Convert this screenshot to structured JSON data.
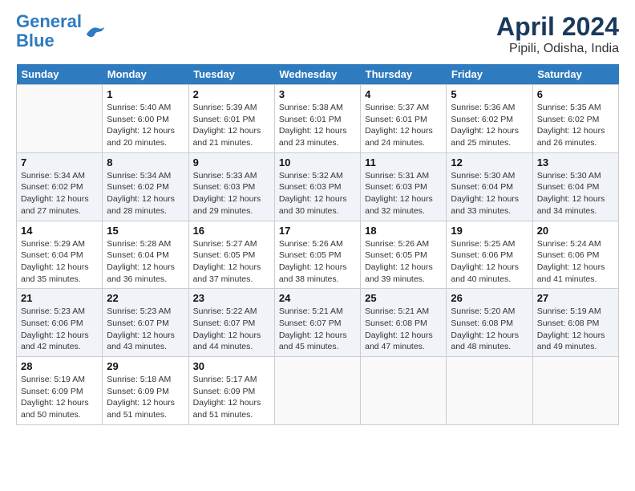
{
  "header": {
    "logo_line1": "General",
    "logo_line2": "Blue",
    "title": "April 2024",
    "subtitle": "Pipili, Odisha, India"
  },
  "days_of_week": [
    "Sunday",
    "Monday",
    "Tuesday",
    "Wednesday",
    "Thursday",
    "Friday",
    "Saturday"
  ],
  "weeks": [
    [
      {
        "day": "",
        "detail": ""
      },
      {
        "day": "1",
        "detail": "Sunrise: 5:40 AM\nSunset: 6:00 PM\nDaylight: 12 hours\nand 20 minutes."
      },
      {
        "day": "2",
        "detail": "Sunrise: 5:39 AM\nSunset: 6:01 PM\nDaylight: 12 hours\nand 21 minutes."
      },
      {
        "day": "3",
        "detail": "Sunrise: 5:38 AM\nSunset: 6:01 PM\nDaylight: 12 hours\nand 23 minutes."
      },
      {
        "day": "4",
        "detail": "Sunrise: 5:37 AM\nSunset: 6:01 PM\nDaylight: 12 hours\nand 24 minutes."
      },
      {
        "day": "5",
        "detail": "Sunrise: 5:36 AM\nSunset: 6:02 PM\nDaylight: 12 hours\nand 25 minutes."
      },
      {
        "day": "6",
        "detail": "Sunrise: 5:35 AM\nSunset: 6:02 PM\nDaylight: 12 hours\nand 26 minutes."
      }
    ],
    [
      {
        "day": "7",
        "detail": "Sunrise: 5:34 AM\nSunset: 6:02 PM\nDaylight: 12 hours\nand 27 minutes."
      },
      {
        "day": "8",
        "detail": "Sunrise: 5:34 AM\nSunset: 6:02 PM\nDaylight: 12 hours\nand 28 minutes."
      },
      {
        "day": "9",
        "detail": "Sunrise: 5:33 AM\nSunset: 6:03 PM\nDaylight: 12 hours\nand 29 minutes."
      },
      {
        "day": "10",
        "detail": "Sunrise: 5:32 AM\nSunset: 6:03 PM\nDaylight: 12 hours\nand 30 minutes."
      },
      {
        "day": "11",
        "detail": "Sunrise: 5:31 AM\nSunset: 6:03 PM\nDaylight: 12 hours\nand 32 minutes."
      },
      {
        "day": "12",
        "detail": "Sunrise: 5:30 AM\nSunset: 6:04 PM\nDaylight: 12 hours\nand 33 minutes."
      },
      {
        "day": "13",
        "detail": "Sunrise: 5:30 AM\nSunset: 6:04 PM\nDaylight: 12 hours\nand 34 minutes."
      }
    ],
    [
      {
        "day": "14",
        "detail": "Sunrise: 5:29 AM\nSunset: 6:04 PM\nDaylight: 12 hours\nand 35 minutes."
      },
      {
        "day": "15",
        "detail": "Sunrise: 5:28 AM\nSunset: 6:04 PM\nDaylight: 12 hours\nand 36 minutes."
      },
      {
        "day": "16",
        "detail": "Sunrise: 5:27 AM\nSunset: 6:05 PM\nDaylight: 12 hours\nand 37 minutes."
      },
      {
        "day": "17",
        "detail": "Sunrise: 5:26 AM\nSunset: 6:05 PM\nDaylight: 12 hours\nand 38 minutes."
      },
      {
        "day": "18",
        "detail": "Sunrise: 5:26 AM\nSunset: 6:05 PM\nDaylight: 12 hours\nand 39 minutes."
      },
      {
        "day": "19",
        "detail": "Sunrise: 5:25 AM\nSunset: 6:06 PM\nDaylight: 12 hours\nand 40 minutes."
      },
      {
        "day": "20",
        "detail": "Sunrise: 5:24 AM\nSunset: 6:06 PM\nDaylight: 12 hours\nand 41 minutes."
      }
    ],
    [
      {
        "day": "21",
        "detail": "Sunrise: 5:23 AM\nSunset: 6:06 PM\nDaylight: 12 hours\nand 42 minutes."
      },
      {
        "day": "22",
        "detail": "Sunrise: 5:23 AM\nSunset: 6:07 PM\nDaylight: 12 hours\nand 43 minutes."
      },
      {
        "day": "23",
        "detail": "Sunrise: 5:22 AM\nSunset: 6:07 PM\nDaylight: 12 hours\nand 44 minutes."
      },
      {
        "day": "24",
        "detail": "Sunrise: 5:21 AM\nSunset: 6:07 PM\nDaylight: 12 hours\nand 45 minutes."
      },
      {
        "day": "25",
        "detail": "Sunrise: 5:21 AM\nSunset: 6:08 PM\nDaylight: 12 hours\nand 47 minutes."
      },
      {
        "day": "26",
        "detail": "Sunrise: 5:20 AM\nSunset: 6:08 PM\nDaylight: 12 hours\nand 48 minutes."
      },
      {
        "day": "27",
        "detail": "Sunrise: 5:19 AM\nSunset: 6:08 PM\nDaylight: 12 hours\nand 49 minutes."
      }
    ],
    [
      {
        "day": "28",
        "detail": "Sunrise: 5:19 AM\nSunset: 6:09 PM\nDaylight: 12 hours\nand 50 minutes."
      },
      {
        "day": "29",
        "detail": "Sunrise: 5:18 AM\nSunset: 6:09 PM\nDaylight: 12 hours\nand 51 minutes."
      },
      {
        "day": "30",
        "detail": "Sunrise: 5:17 AM\nSunset: 6:09 PM\nDaylight: 12 hours\nand 51 minutes."
      },
      {
        "day": "",
        "detail": ""
      },
      {
        "day": "",
        "detail": ""
      },
      {
        "day": "",
        "detail": ""
      },
      {
        "day": "",
        "detail": ""
      }
    ]
  ]
}
